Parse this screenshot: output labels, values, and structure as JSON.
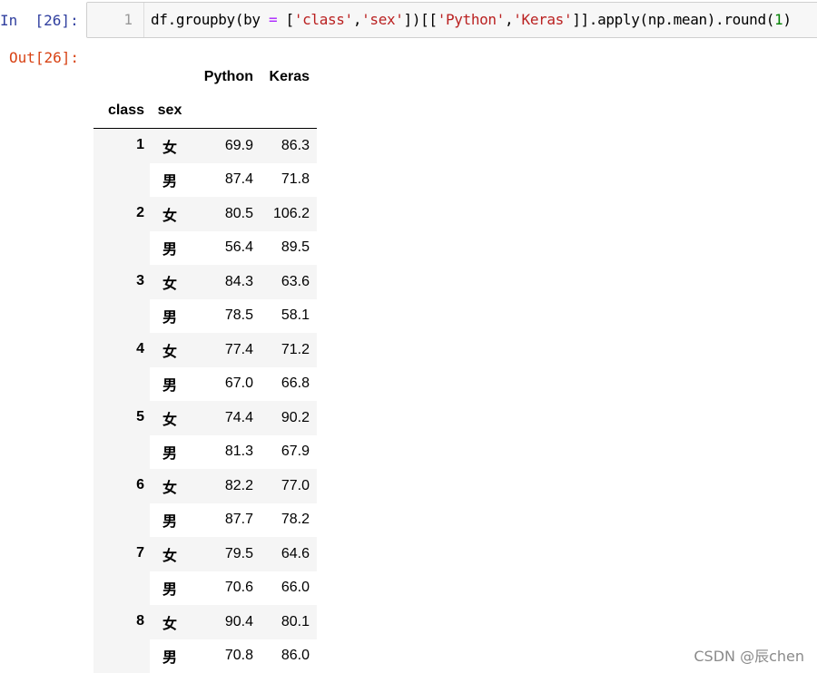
{
  "input_cell": {
    "prompt": "In  [26]:",
    "line_number": "1",
    "code_tokens": [
      {
        "t": "df.groupby(by ",
        "c": ""
      },
      {
        "t": "=",
        "c": "op"
      },
      {
        "t": " [",
        "c": ""
      },
      {
        "t": "'class'",
        "c": "str"
      },
      {
        "t": ",",
        "c": ""
      },
      {
        "t": "'sex'",
        "c": "str"
      },
      {
        "t": "])[[",
        "c": ""
      },
      {
        "t": "'Python'",
        "c": "str"
      },
      {
        "t": ",",
        "c": ""
      },
      {
        "t": "'Keras'",
        "c": "str"
      },
      {
        "t": "]].apply(np.mean).round(",
        "c": ""
      },
      {
        "t": "1",
        "c": "num"
      },
      {
        "t": ")",
        "c": ""
      }
    ]
  },
  "output_cell": {
    "prompt": "Out[26]:"
  },
  "dataframe": {
    "columns": [
      "Python",
      "Keras"
    ],
    "index_names": [
      "class",
      "sex"
    ],
    "groups": [
      {
        "class": "1",
        "rows": [
          {
            "sex": "女",
            "python": "69.9",
            "keras": "86.3"
          },
          {
            "sex": "男",
            "python": "87.4",
            "keras": "71.8"
          }
        ]
      },
      {
        "class": "2",
        "rows": [
          {
            "sex": "女",
            "python": "80.5",
            "keras": "106.2"
          },
          {
            "sex": "男",
            "python": "56.4",
            "keras": "89.5"
          }
        ]
      },
      {
        "class": "3",
        "rows": [
          {
            "sex": "女",
            "python": "84.3",
            "keras": "63.6"
          },
          {
            "sex": "男",
            "python": "78.5",
            "keras": "58.1"
          }
        ]
      },
      {
        "class": "4",
        "rows": [
          {
            "sex": "女",
            "python": "77.4",
            "keras": "71.2"
          },
          {
            "sex": "男",
            "python": "67.0",
            "keras": "66.8"
          }
        ]
      },
      {
        "class": "5",
        "rows": [
          {
            "sex": "女",
            "python": "74.4",
            "keras": "90.2"
          },
          {
            "sex": "男",
            "python": "81.3",
            "keras": "67.9"
          }
        ]
      },
      {
        "class": "6",
        "rows": [
          {
            "sex": "女",
            "python": "82.2",
            "keras": "77.0"
          },
          {
            "sex": "男",
            "python": "87.7",
            "keras": "78.2"
          }
        ]
      },
      {
        "class": "7",
        "rows": [
          {
            "sex": "女",
            "python": "79.5",
            "keras": "64.6"
          },
          {
            "sex": "男",
            "python": "70.6",
            "keras": "66.0"
          }
        ]
      },
      {
        "class": "8",
        "rows": [
          {
            "sex": "女",
            "python": "90.4",
            "keras": "80.1"
          },
          {
            "sex": "男",
            "python": "70.8",
            "keras": "86.0"
          }
        ]
      }
    ]
  },
  "watermark": "CSDN @辰chen"
}
